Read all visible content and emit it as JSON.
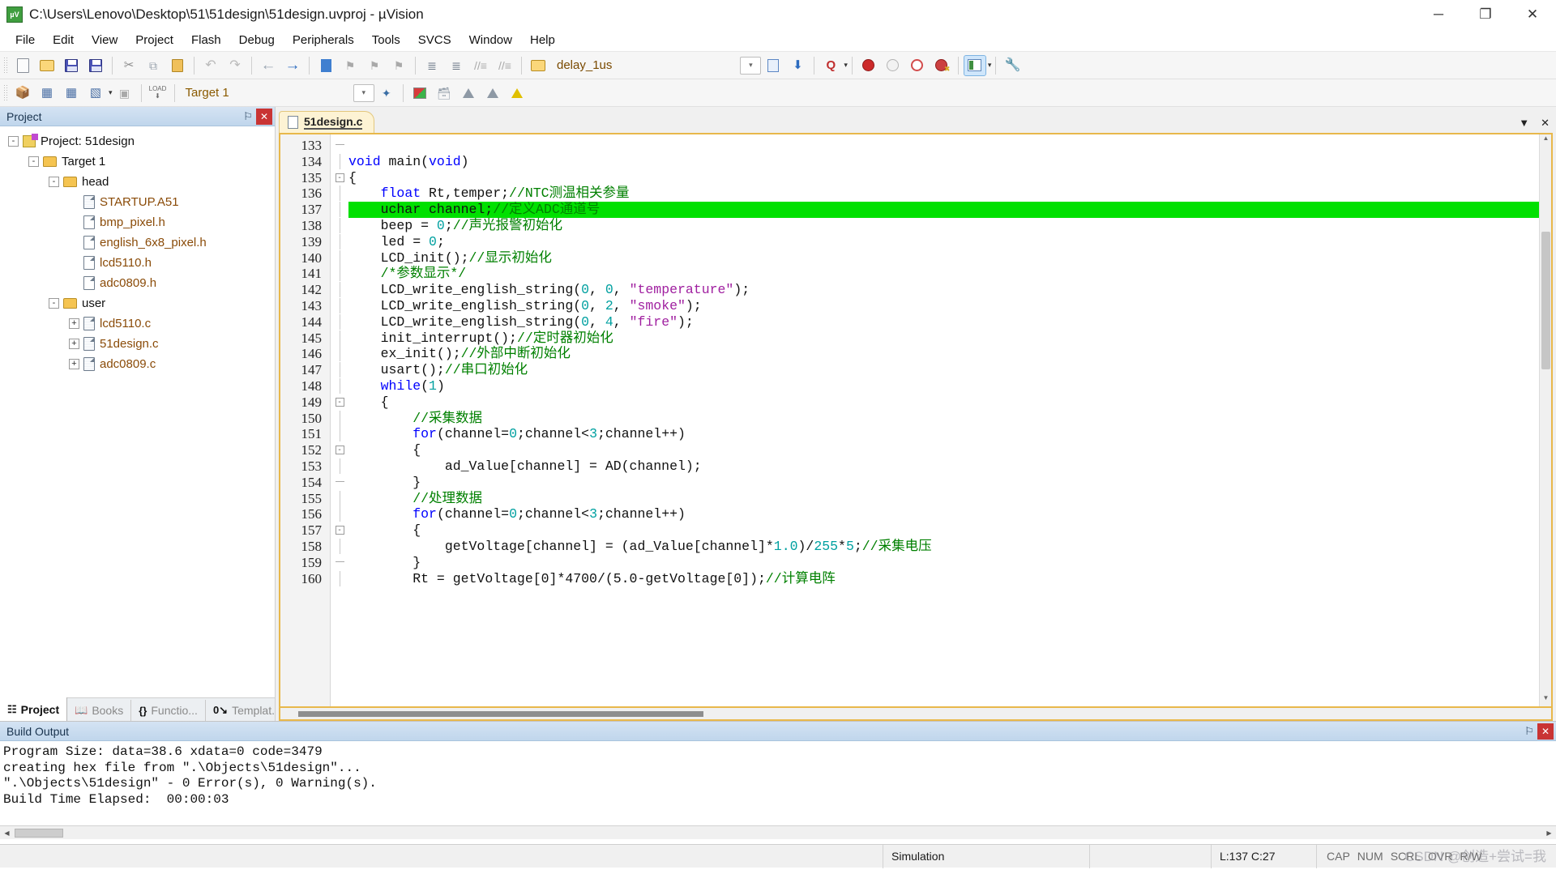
{
  "window": {
    "title": "C:\\Users\\Lenovo\\Desktop\\51\\51design\\51design.uvproj - µVision",
    "app_icon_label": "µV",
    "minimize": "─",
    "maximize": "❐",
    "close": "✕"
  },
  "menu": {
    "items": [
      {
        "label": "File"
      },
      {
        "label": "Edit"
      },
      {
        "label": "View"
      },
      {
        "label": "Project"
      },
      {
        "label": "Flash"
      },
      {
        "label": "Debug"
      },
      {
        "label": "Peripherals"
      },
      {
        "label": "Tools"
      },
      {
        "label": "SVCS"
      },
      {
        "label": "Window"
      },
      {
        "label": "Help"
      }
    ]
  },
  "toolbar_main": {
    "find_target_value": "delay_1us",
    "items": [
      {
        "name": "new-file-icon",
        "glyph": ""
      },
      {
        "name": "open-file-icon",
        "glyph": ""
      },
      {
        "name": "save-icon",
        "glyph": ""
      },
      {
        "name": "save-all-icon",
        "glyph": ""
      },
      {
        "name": "cut-icon",
        "glyph": "✂"
      },
      {
        "name": "copy-icon",
        "glyph": "⧉"
      },
      {
        "name": "paste-icon",
        "glyph": ""
      },
      {
        "name": "undo-icon",
        "glyph": "↶"
      },
      {
        "name": "redo-icon",
        "glyph": "↷"
      },
      {
        "name": "navigate-back-icon",
        "glyph": "←"
      },
      {
        "name": "navigate-forward-icon",
        "glyph": "→"
      },
      {
        "name": "toggle-bookmark-icon",
        "glyph": ""
      },
      {
        "name": "previous-bookmark-icon",
        "glyph": ""
      },
      {
        "name": "next-bookmark-icon",
        "glyph": ""
      },
      {
        "name": "clear-bookmarks-icon",
        "glyph": ""
      },
      {
        "name": "indent-icon",
        "glyph": "≡"
      },
      {
        "name": "outdent-icon",
        "glyph": "≡"
      },
      {
        "name": "comment-icon",
        "glyph": "⁄⁄"
      },
      {
        "name": "uncomment-icon",
        "glyph": "⁄⁄"
      },
      {
        "name": "open-folder-icon",
        "glyph": ""
      },
      {
        "name": "bookmark-list-icon",
        "glyph": ""
      },
      {
        "name": "find-in-files-icon",
        "glyph": ""
      },
      {
        "name": "find-icon",
        "glyph": "Q"
      },
      {
        "name": "insert-breakpoint-icon",
        "glyph": ""
      },
      {
        "name": "disable-breakpoint-icon",
        "glyph": ""
      },
      {
        "name": "disable-all-breakpoints-icon",
        "glyph": ""
      },
      {
        "name": "kill-all-breakpoints-icon",
        "glyph": ""
      },
      {
        "name": "configuration-wizard-icon",
        "glyph": ""
      },
      {
        "name": "utilities-icon",
        "glyph": "🔧"
      }
    ]
  },
  "toolbar_build": {
    "target_value": "Target 1",
    "items": [
      {
        "name": "translate-icon"
      },
      {
        "name": "build-icon"
      },
      {
        "name": "rebuild-icon"
      },
      {
        "name": "batch-build-icon"
      },
      {
        "name": "stop-build-icon"
      },
      {
        "name": "download-icon"
      },
      {
        "name": "manage-project-items-icon"
      },
      {
        "name": "target-options-icon"
      },
      {
        "name": "manage-run-time-icon"
      },
      {
        "name": "multi-project-icon"
      },
      {
        "name": "pack-installer-icon"
      }
    ]
  },
  "project_panel": {
    "title": "Project",
    "pin_icon": "⚐",
    "close_icon": "✕",
    "tree": [
      {
        "label": "Project: 51design",
        "indent": 0,
        "expander": "-",
        "icon": "project-icon",
        "kind": "root"
      },
      {
        "label": "Target 1",
        "indent": 1,
        "expander": "-",
        "icon": "target-folder-icon",
        "kind": "root2"
      },
      {
        "label": "head",
        "indent": 2,
        "expander": "-",
        "icon": "folder-icon",
        "kind": "root2"
      },
      {
        "label": "STARTUP.A51",
        "indent": 3,
        "expander": "",
        "icon": "source-file-icon",
        "kind": "file"
      },
      {
        "label": "bmp_pixel.h",
        "indent": 3,
        "expander": "",
        "icon": "header-file-icon",
        "kind": "file"
      },
      {
        "label": "english_6x8_pixel.h",
        "indent": 3,
        "expander": "",
        "icon": "header-file-icon",
        "kind": "file"
      },
      {
        "label": "lcd5110.h",
        "indent": 3,
        "expander": "",
        "icon": "header-file-icon",
        "kind": "file"
      },
      {
        "label": "adc0809.h",
        "indent": 3,
        "expander": "",
        "icon": "header-file-icon",
        "kind": "file"
      },
      {
        "label": "user",
        "indent": 2,
        "expander": "-",
        "icon": "folder-icon",
        "kind": "root2"
      },
      {
        "label": "lcd5110.c",
        "indent": 3,
        "expander": "+",
        "icon": "source-file-icon",
        "kind": "file"
      },
      {
        "label": "51design.c",
        "indent": 3,
        "expander": "+",
        "icon": "source-file-icon",
        "kind": "file"
      },
      {
        "label": "adc0809.c",
        "indent": 3,
        "expander": "+",
        "icon": "source-file-icon",
        "kind": "file"
      }
    ],
    "tabs": [
      {
        "label": "Project",
        "icon": "project-tab-icon",
        "selected": true
      },
      {
        "label": "Books",
        "icon": "books-tab-icon",
        "selected": false
      },
      {
        "label": "Functio...",
        "icon": "functions-tab-icon",
        "selected": false
      },
      {
        "label": "Templat...",
        "icon": "templates-tab-icon",
        "selected": false
      }
    ]
  },
  "editor": {
    "tab_label": "51design.c",
    "menu_caret": "▼",
    "close": "✕",
    "first_line_number": 133,
    "lines": [
      {
        "n": 133,
        "fold": "end",
        "tokens": []
      },
      {
        "n": 134,
        "fold": "bar",
        "tokens": [
          {
            "t": "void ",
            "c": "kw"
          },
          {
            "t": "main",
            "c": "fnc"
          },
          {
            "t": "(",
            "c": "punc"
          },
          {
            "t": "void",
            "c": "kw"
          },
          {
            "t": ")",
            "c": "punc"
          }
        ]
      },
      {
        "n": 135,
        "fold": "minus",
        "tokens": [
          {
            "t": "{",
            "c": "punc"
          }
        ]
      },
      {
        "n": 136,
        "fold": "bar",
        "tokens": [
          {
            "t": "    ",
            "c": "punc"
          },
          {
            "t": "float",
            "c": "kw"
          },
          {
            "t": " Rt,temper;",
            "c": "punc"
          },
          {
            "t": "//NTC测温相关参量",
            "c": "com"
          }
        ]
      },
      {
        "n": 137,
        "fold": "bar",
        "highlight": true,
        "tokens": [
          {
            "t": "    uchar channel;",
            "c": "punc"
          },
          {
            "t": "//定义ADC通道号",
            "c": "com"
          }
        ]
      },
      {
        "n": 138,
        "fold": "bar",
        "tokens": [
          {
            "t": "    beep = ",
            "c": "punc"
          },
          {
            "t": "0",
            "c": "num"
          },
          {
            "t": ";",
            "c": "punc"
          },
          {
            "t": "//声光报警初始化",
            "c": "com"
          }
        ]
      },
      {
        "n": 139,
        "fold": "bar",
        "tokens": [
          {
            "t": "    led = ",
            "c": "punc"
          },
          {
            "t": "0",
            "c": "num"
          },
          {
            "t": ";",
            "c": "punc"
          }
        ]
      },
      {
        "n": 140,
        "fold": "bar",
        "tokens": [
          {
            "t": "    LCD_init();",
            "c": "punc"
          },
          {
            "t": "//显示初始化",
            "c": "com"
          }
        ]
      },
      {
        "n": 141,
        "fold": "bar",
        "tokens": [
          {
            "t": "    /*参数显示*/",
            "c": "com"
          }
        ]
      },
      {
        "n": 142,
        "fold": "bar",
        "tokens": [
          {
            "t": "    LCD_write_english_string(",
            "c": "punc"
          },
          {
            "t": "0",
            "c": "num"
          },
          {
            "t": ", ",
            "c": "punc"
          },
          {
            "t": "0",
            "c": "num"
          },
          {
            "t": ", ",
            "c": "punc"
          },
          {
            "t": "\"temperature\"",
            "c": "str"
          },
          {
            "t": ");",
            "c": "punc"
          }
        ]
      },
      {
        "n": 143,
        "fold": "bar",
        "tokens": [
          {
            "t": "    LCD_write_english_string(",
            "c": "punc"
          },
          {
            "t": "0",
            "c": "num"
          },
          {
            "t": ", ",
            "c": "punc"
          },
          {
            "t": "2",
            "c": "num"
          },
          {
            "t": ", ",
            "c": "punc"
          },
          {
            "t": "\"smoke\"",
            "c": "str"
          },
          {
            "t": ");",
            "c": "punc"
          }
        ]
      },
      {
        "n": 144,
        "fold": "bar",
        "tokens": [
          {
            "t": "    LCD_write_english_string(",
            "c": "punc"
          },
          {
            "t": "0",
            "c": "num"
          },
          {
            "t": ", ",
            "c": "punc"
          },
          {
            "t": "4",
            "c": "num"
          },
          {
            "t": ", ",
            "c": "punc"
          },
          {
            "t": "\"fire\"",
            "c": "str"
          },
          {
            "t": ");",
            "c": "punc"
          }
        ]
      },
      {
        "n": 145,
        "fold": "bar",
        "tokens": [
          {
            "t": "    init_interrupt();",
            "c": "punc"
          },
          {
            "t": "//定时器初始化",
            "c": "com"
          }
        ]
      },
      {
        "n": 146,
        "fold": "bar",
        "tokens": [
          {
            "t": "    ex_init();",
            "c": "punc"
          },
          {
            "t": "//外部中断初始化",
            "c": "com"
          }
        ]
      },
      {
        "n": 147,
        "fold": "bar",
        "tokens": [
          {
            "t": "    usart();",
            "c": "punc"
          },
          {
            "t": "//串口初始化",
            "c": "com"
          }
        ]
      },
      {
        "n": 148,
        "fold": "bar",
        "tokens": [
          {
            "t": "    ",
            "c": "punc"
          },
          {
            "t": "while",
            "c": "kw"
          },
          {
            "t": "(",
            "c": "punc"
          },
          {
            "t": "1",
            "c": "num"
          },
          {
            "t": ")",
            "c": "punc"
          }
        ]
      },
      {
        "n": 149,
        "fold": "minus",
        "tokens": [
          {
            "t": "    {",
            "c": "punc"
          }
        ]
      },
      {
        "n": 150,
        "fold": "bar",
        "tokens": [
          {
            "t": "        ",
            "c": "punc"
          },
          {
            "t": "//采集数据",
            "c": "com"
          }
        ]
      },
      {
        "n": 151,
        "fold": "bar",
        "tokens": [
          {
            "t": "        ",
            "c": "punc"
          },
          {
            "t": "for",
            "c": "kw"
          },
          {
            "t": "(channel=",
            "c": "punc"
          },
          {
            "t": "0",
            "c": "num"
          },
          {
            "t": ";channel<",
            "c": "punc"
          },
          {
            "t": "3",
            "c": "num"
          },
          {
            "t": ";channel++)",
            "c": "punc"
          }
        ]
      },
      {
        "n": 152,
        "fold": "minus",
        "tokens": [
          {
            "t": "        {",
            "c": "punc"
          }
        ]
      },
      {
        "n": 153,
        "fold": "bar",
        "tokens": [
          {
            "t": "            ad_Value[channel] = AD(channel);",
            "c": "punc"
          }
        ]
      },
      {
        "n": 154,
        "fold": "end",
        "tokens": [
          {
            "t": "        }",
            "c": "punc"
          }
        ]
      },
      {
        "n": 155,
        "fold": "bar",
        "tokens": [
          {
            "t": "        ",
            "c": "punc"
          },
          {
            "t": "//处理数据",
            "c": "com"
          }
        ]
      },
      {
        "n": 156,
        "fold": "bar",
        "tokens": [
          {
            "t": "        ",
            "c": "punc"
          },
          {
            "t": "for",
            "c": "kw"
          },
          {
            "t": "(channel=",
            "c": "punc"
          },
          {
            "t": "0",
            "c": "num"
          },
          {
            "t": ";channel<",
            "c": "punc"
          },
          {
            "t": "3",
            "c": "num"
          },
          {
            "t": ";channel++)",
            "c": "punc"
          }
        ]
      },
      {
        "n": 157,
        "fold": "minus",
        "tokens": [
          {
            "t": "        {",
            "c": "punc"
          }
        ]
      },
      {
        "n": 158,
        "fold": "bar",
        "tokens": [
          {
            "t": "            getVoltage[channel] = (ad_Value[channel]*",
            "c": "punc"
          },
          {
            "t": "1.0",
            "c": "num"
          },
          {
            "t": ")/",
            "c": "punc"
          },
          {
            "t": "255",
            "c": "num"
          },
          {
            "t": "*",
            "c": "punc"
          },
          {
            "t": "5",
            "c": "num"
          },
          {
            "t": ";",
            "c": "punc"
          },
          {
            "t": "//采集电压",
            "c": "com"
          }
        ]
      },
      {
        "n": 159,
        "fold": "end",
        "tokens": [
          {
            "t": "        }",
            "c": "punc"
          }
        ]
      },
      {
        "n": 160,
        "fold": "bar",
        "tokens": [
          {
            "t": "        Rt = getVoltage[0]*4700/(5.0-getVoltage[0]);",
            "c": "punc"
          },
          {
            "t": "//计算电阵",
            "c": "com"
          }
        ]
      }
    ]
  },
  "build_output": {
    "title": "Build Output",
    "pin_icon": "⚐",
    "close_icon": "✕",
    "lines": [
      "Program Size: data=38.6 xdata=0 code=3479",
      "creating hex file from \".\\Objects\\51design\"...",
      "\".\\Objects\\51design\" - 0 Error(s), 0 Warning(s).",
      "Build Time Elapsed:  00:00:03"
    ]
  },
  "statusbar": {
    "mode": "Simulation",
    "cursor": "L:137 C:27",
    "flags": [
      "CAP",
      "NUM",
      "SCRL",
      "OVR",
      "R/W"
    ],
    "watermark": "CSDN @创造+尝试=我"
  },
  "colors": {
    "highlight_line": "#00e000",
    "keyword": "#0000ff",
    "comment": "#008000",
    "string": "#a020a0",
    "number": "#00a0a0",
    "tree_text": "#8a4b08",
    "caption": "#c0d6ec",
    "editor_border": "#e8b84b"
  }
}
